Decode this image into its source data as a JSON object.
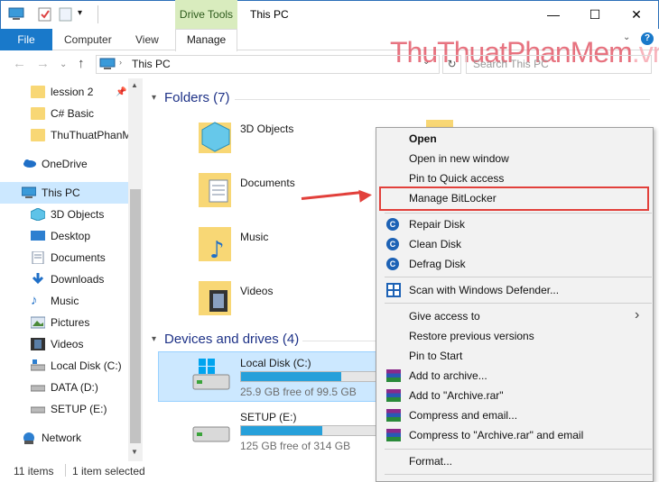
{
  "titlebar": {
    "window_title": "This PC",
    "contextual_tab": "Drive Tools",
    "controls": {
      "minimize": "—",
      "maximize": "☐",
      "close": "✕"
    }
  },
  "ribbon": {
    "tabs": [
      "File",
      "Computer",
      "View",
      "Manage"
    ],
    "help": "?",
    "collapse": "⌄"
  },
  "address_bar": {
    "nav": {
      "back": "←",
      "forward": "→",
      "recent": "⌄",
      "up": "↑"
    },
    "path": "This PC",
    "dropdown": "⌄",
    "refresh": "↻",
    "search_placeholder": "Search This PC"
  },
  "watermark": {
    "part1": "ThuThuat",
    "part2": "PhanMem",
    "part3": ".vn"
  },
  "sidebar": {
    "quick_access": [
      {
        "label": "lession 2",
        "pinned": true
      },
      {
        "label": "C# Basic",
        "pinned": false
      },
      {
        "label": "ThuThuatPhanM",
        "pinned": false
      }
    ],
    "onedrive": "OneDrive",
    "this_pc": "This PC",
    "this_pc_children": [
      "3D Objects",
      "Desktop",
      "Documents",
      "Downloads",
      "Music",
      "Pictures",
      "Videos",
      "Local Disk (C:)",
      "DATA (D:)",
      "SETUP (E:)"
    ],
    "network": "Network"
  },
  "main": {
    "folders_header": "Folders (7)",
    "folders": [
      "3D Objects",
      "Documents",
      "Music",
      "Videos"
    ],
    "devices_header": "Devices and drives (4)",
    "drives": [
      {
        "name": "Local Disk (C:)",
        "free": "25.9 GB free of 99.5 GB",
        "used_fraction": 0.74
      },
      {
        "name": "SETUP (E:)",
        "free": "125 GB free of 314 GB",
        "used_fraction": 0.6
      }
    ]
  },
  "status": {
    "items": "11 items",
    "selected": "1 item selected"
  },
  "context_menu": {
    "items": [
      "Open",
      "Open in new window",
      "Pin to Quick access",
      "Manage BitLocker",
      "Repair Disk",
      "Clean Disk",
      "Defrag Disk",
      "Scan with Windows Defender...",
      "Give access to",
      "Restore previous versions",
      "Pin to Start",
      "Add to archive...",
      "Add to \"Archive.rar\"",
      "Compress and email...",
      "Compress to \"Archive.rar\" and email",
      "Format..."
    ],
    "submenu_arrow": "›"
  },
  "colors": {
    "accent": "#1979ca",
    "highlight": "#e2403b",
    "selection": "#cce8ff"
  }
}
